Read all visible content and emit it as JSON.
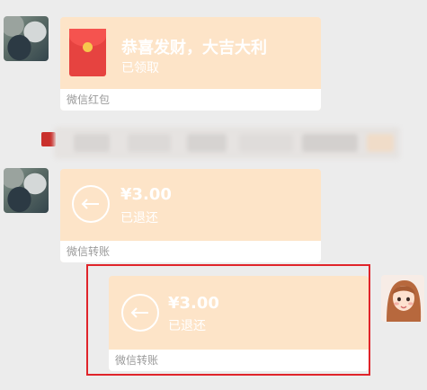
{
  "messages": {
    "red_packet": {
      "title": "恭喜发财，大吉大利",
      "status": "已领取",
      "source": "微信红包"
    },
    "transfer_1": {
      "amount": "¥3.00",
      "status": "已退还",
      "source": "微信转账"
    },
    "transfer_2": {
      "amount": "¥3.00",
      "status": "已退还",
      "source": "微信转账"
    }
  },
  "colors": {
    "bubble_background": "#fde4c8",
    "bubble_text": "#ffffff",
    "footer_text": "#9a9a9a",
    "chat_background": "#ececec",
    "red_packet": "#e64340",
    "highlight_frame": "#e0242a"
  },
  "icons": {
    "red_packet": "red-envelope-icon",
    "transfer": "return-arrow-icon"
  }
}
